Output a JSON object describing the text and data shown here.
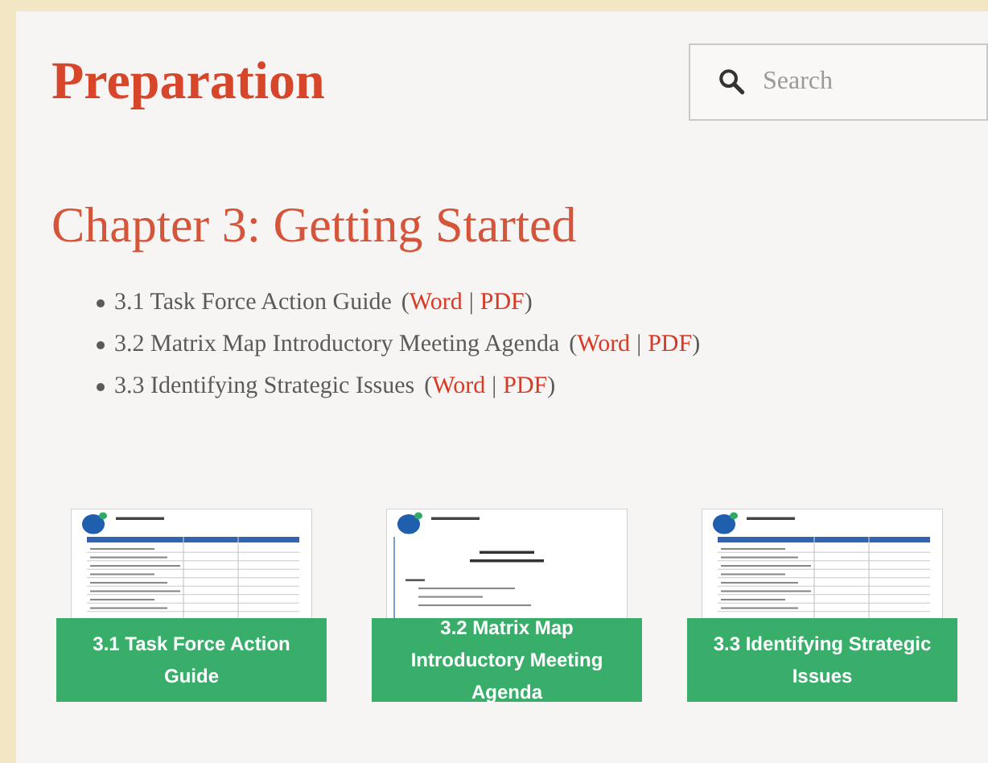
{
  "page_title": "Preparation",
  "search": {
    "placeholder": "Search"
  },
  "chapter_heading": "Chapter 3: Getting Started",
  "documents": [
    {
      "label": "3.1 Task Force Action Guide",
      "open": "(",
      "links": [
        "Word",
        "PDF"
      ],
      "separator": "|",
      "close": ")"
    },
    {
      "label": "3.2 Matrix Map Introductory  Meeting Agenda",
      "open": "(",
      "links": [
        "Word",
        "PDF"
      ],
      "separator": "|",
      "close": ")"
    },
    {
      "label": "3.3 Identifying Strategic Issues",
      "open": "(",
      "links": [
        "Word",
        "PDF"
      ],
      "separator": "|",
      "close": ")"
    }
  ],
  "cards": [
    {
      "caption": "3.1 Task Force Action Guide",
      "kind": "table"
    },
    {
      "caption": "3.2 Matrix Map Introductory Meeting Agenda",
      "kind": "agenda"
    },
    {
      "caption": "3.3 Identifying Strategic Issues",
      "kind": "table"
    }
  ]
}
